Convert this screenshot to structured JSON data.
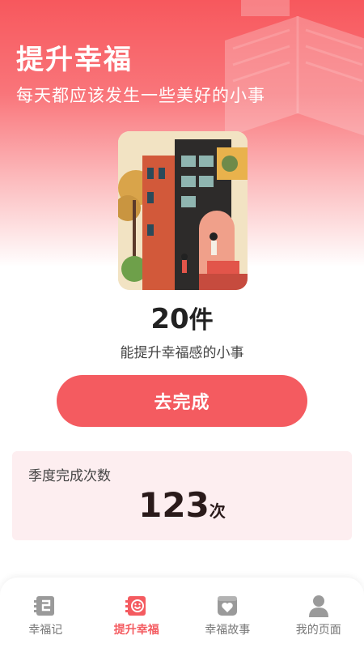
{
  "header": {
    "title": "提升幸福",
    "subtitle": "每天都应该发生一些美好的小事"
  },
  "summary": {
    "count": "20",
    "unit": "件",
    "description": "能提升幸福感的小事"
  },
  "action": {
    "button_label": "去完成"
  },
  "stats": {
    "label": "季度完成次数",
    "value": "123",
    "unit": "次"
  },
  "tabbar": {
    "active_index": 1,
    "items": [
      {
        "label": "幸福记",
        "icon": "journal-icon"
      },
      {
        "label": "提升幸福",
        "icon": "smile-book-icon"
      },
      {
        "label": "幸福故事",
        "icon": "heart-box-icon"
      },
      {
        "label": "我的页面",
        "icon": "person-icon"
      }
    ]
  },
  "colors": {
    "accent": "#f45b60",
    "card_bg": "#fdeef0",
    "inactive": "#9a9a9a"
  }
}
